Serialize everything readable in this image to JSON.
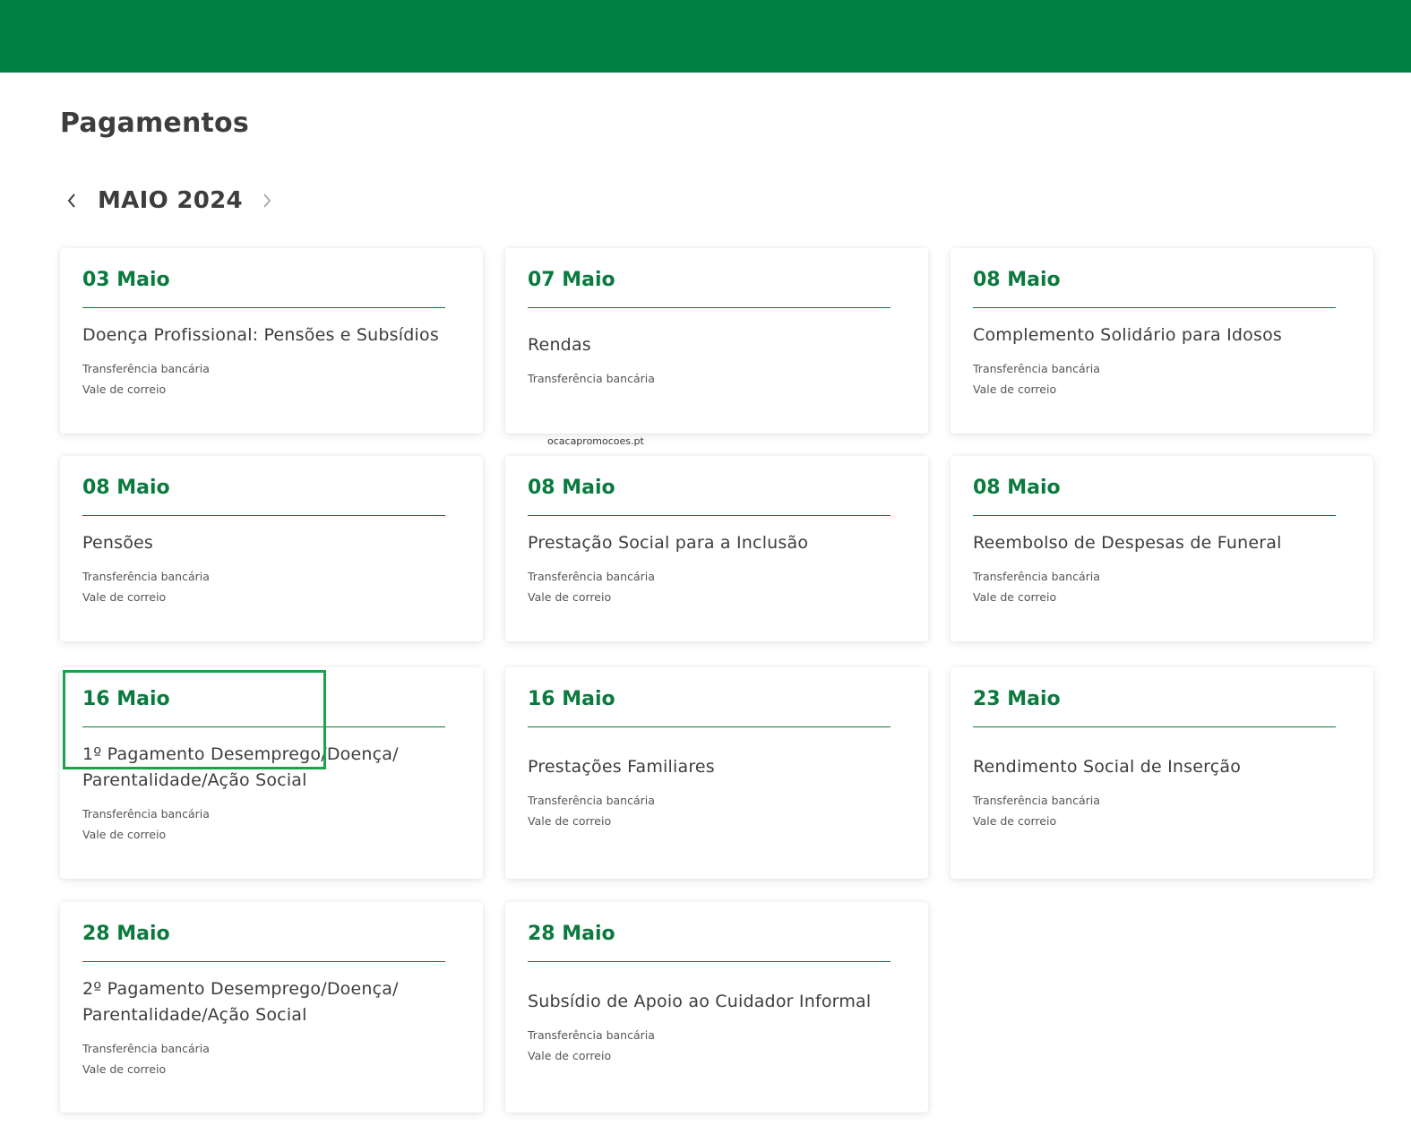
{
  "header": {
    "brand_color": "#007f45"
  },
  "page": {
    "title": "Pagamentos"
  },
  "month_nav": {
    "label": "MAIO 2024",
    "prev_icon": "chevron-left-icon",
    "next_icon": "chevron-right-icon"
  },
  "watermark": "ocacapromocoes.pt",
  "accent_color": "#0b7a3e",
  "highlight_color": "#1aa34a",
  "cards": [
    {
      "date": "03 Maio",
      "name": "Doença Profissional: Pensões e Subsídios",
      "methods": [
        "Transferência bancária",
        "Vale de correio"
      ]
    },
    {
      "date": "07 Maio",
      "name": "Rendas",
      "methods": [
        "Transferência bancária"
      ]
    },
    {
      "date": "08 Maio",
      "name": "Complemento Solidário para Idosos",
      "methods": [
        "Transferência bancária",
        "Vale de correio"
      ]
    },
    {
      "date": "08 Maio",
      "name": "Pensões",
      "methods": [
        "Transferência bancária",
        "Vale de correio"
      ]
    },
    {
      "date": "08 Maio",
      "name": "Prestação Social para a Inclusão",
      "methods": [
        "Transferência bancária",
        "Vale de correio"
      ]
    },
    {
      "date": "08 Maio",
      "name": "Reembolso de Despesas de Funeral",
      "methods": [
        "Transferência bancária",
        "Vale de correio"
      ]
    },
    {
      "date": "16 Maio",
      "name": "1º Pagamento Desemprego/Doença/ Parentalidade/Ação Social",
      "methods": [
        "Transferência bancária",
        "Vale de correio"
      ]
    },
    {
      "date": "16 Maio",
      "name": "Prestações Familiares",
      "methods": [
        "Transferência bancária",
        "Vale de correio"
      ]
    },
    {
      "date": "23 Maio",
      "name": "Rendimento Social de Inserção",
      "methods": [
        "Transferência bancária",
        "Vale de correio"
      ]
    },
    {
      "date": "28 Maio",
      "name": "2º Pagamento Desemprego/Doença/ Parentalidade/Ação Social",
      "methods": [
        "Transferência bancária",
        "Vale de correio"
      ]
    },
    {
      "date": "28 Maio",
      "name": "Subsídio de Apoio ao Cuidador Informal",
      "methods": [
        "Transferência bancária",
        "Vale de correio"
      ]
    }
  ]
}
